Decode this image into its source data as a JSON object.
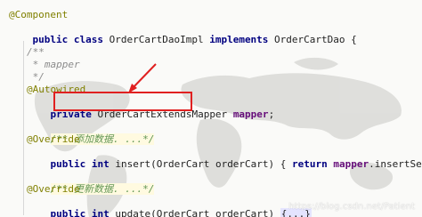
{
  "code": {
    "l1": "@Component",
    "l2": {
      "kw1": "public class",
      "cls": " OrderCartDaoImpl ",
      "kw2": "implements",
      "iface": " OrderCartDao {"
    },
    "l3": "/**",
    "l4": " * mapper",
    "l5": " */",
    "l6": "@Autowired",
    "l7": {
      "kw": "private ",
      "type": "OrderCartExtendsMapper ",
      "field": "mapper",
      "end": ";"
    },
    "l8": "/** 添加数据. ...*/",
    "l9": "@Override",
    "l10": {
      "kw": "public int ",
      "rest1": "insert(OrderCart orderCart) { ",
      "ret": "return ",
      "field": "mapper",
      "rest2": ".insertSelective(orderCart); }"
    },
    "l11": "/** 更新数据. ...*/",
    "l12": "@Override",
    "l13": {
      "kw": "public int ",
      "rest1": "update(OrderCart orderCart) ",
      "fold": "{...}"
    }
  },
  "watermark": "https://blog.csdn.net/Patient"
}
